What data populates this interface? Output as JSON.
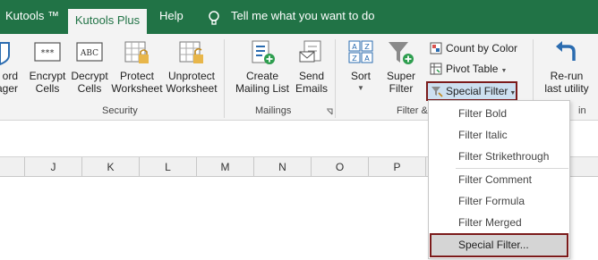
{
  "tabs": {
    "kutools": "Kutools ™",
    "kutools_plus": "Kutools Plus",
    "help": "Help",
    "tell_me": "Tell me what you want to do"
  },
  "ribbon": {
    "partial_left": "ord\nager",
    "security": {
      "encrypt": "Encrypt\nCells",
      "decrypt": "Decrypt\nCells",
      "protect": "Protect\nWorksheet",
      "unprotect": "Unprotect\nWorksheet",
      "label": "Security"
    },
    "mailings": {
      "create": "Create\nMailing List",
      "send": "Send\nEmails",
      "label": "Mailings"
    },
    "filter": {
      "sort": "Sort",
      "super": "Super\nFilter",
      "count_by_color": "Count by Color",
      "pivot_table": "Pivot Table",
      "special_filter": "Special Filter",
      "label": "Filter &"
    },
    "rerun": {
      "label": "Re-run\nlast utility",
      "group_partial": "in"
    }
  },
  "columns": [
    "J",
    "K",
    "L",
    "M",
    "N",
    "O",
    "P"
  ],
  "menu": {
    "items": [
      "Filter Bold",
      "Filter Italic",
      "Filter Strikethrough",
      "Filter Comment",
      "Filter Formula",
      "Filter Merged"
    ],
    "last": "Special Filter..."
  },
  "colors": {
    "tab_green": "#217346",
    "highlight_border": "#7b1b1b",
    "selected_bg": "#cde0f0"
  }
}
